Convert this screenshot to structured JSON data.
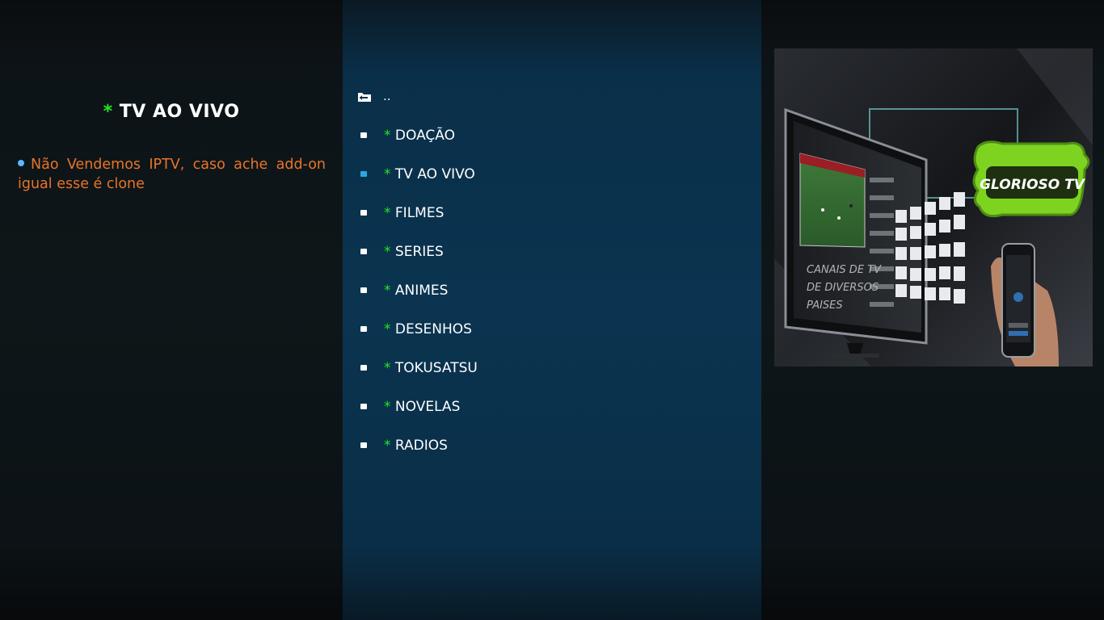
{
  "info": {
    "title_star": "*",
    "title": "TV AO VIVO",
    "plot": "Não Vendemos IPTV, caso ache add-on igual esse é clone"
  },
  "list": {
    "parent_label": "..",
    "items": [
      {
        "star": "*",
        "label": "DOAÇÃO"
      },
      {
        "star": "*",
        "label": "TV AO VIVO",
        "selected": true
      },
      {
        "star": "*",
        "label": "FILMES"
      },
      {
        "star": "*",
        "label": "SERIES"
      },
      {
        "star": "*",
        "label": "ANIMES"
      },
      {
        "star": "*",
        "label": "DESENHOS"
      },
      {
        "star": "*",
        "label": "TOKUSATSU"
      },
      {
        "star": "*",
        "label": "NOVELAS"
      },
      {
        "star": "*",
        "label": "RADIOS"
      }
    ]
  },
  "poster": {
    "logo_text": "GLORIOSO TV",
    "tv_text_line1": "CANAIS DE TV",
    "tv_text_line2": "DE DIVERSOS",
    "tv_text_line3": "PAISES"
  },
  "colors": {
    "accent_star": "#22e81f",
    "plot_text": "#e8742a",
    "selected_bullet": "#2aa9e0",
    "logo_green": "#7ed321"
  }
}
